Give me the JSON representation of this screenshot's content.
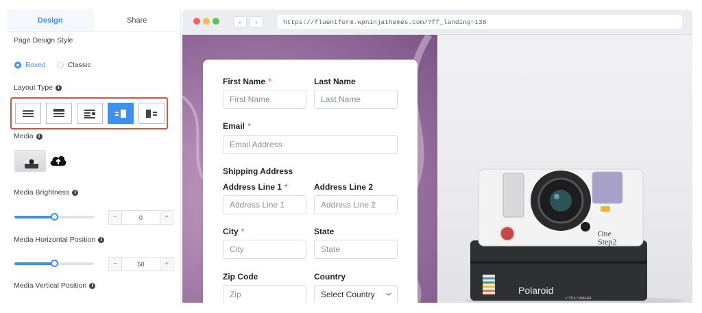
{
  "panel": {
    "tabs": [
      {
        "label": "Design",
        "active": true
      },
      {
        "label": "Share",
        "active": false
      }
    ],
    "page_design_style_label": "Page Design Style",
    "style_options": [
      {
        "label": "Boxed",
        "checked": true
      },
      {
        "label": "Classic",
        "checked": false
      }
    ],
    "layout_type_label": "Layout Type",
    "layout_options_selected_index": 3,
    "media_label": "Media",
    "brightness": {
      "label": "Media Brightness",
      "value": "0",
      "minus": "−",
      "plus": "+"
    },
    "horizontal": {
      "label": "Media Horizontal Position",
      "value": "50",
      "minus": "−",
      "plus": "+"
    },
    "vertical_label": "Media Vertical Position",
    "info_glyph": "i",
    "highlight_color": "#d9533b",
    "accent_color": "#3f8ff2"
  },
  "browser": {
    "url": "https://fluentform.wpninjathemes.com/?ff_landing=138",
    "back_glyph": "‹",
    "forward_glyph": "›",
    "traffic_lights": [
      "#f2655a",
      "#f5bd4f",
      "#57c853"
    ]
  },
  "form": {
    "required_mark": "*",
    "first_name": {
      "label": "First Name",
      "placeholder": "First Name"
    },
    "last_name": {
      "label": "Last Name",
      "placeholder": "Last Name"
    },
    "email": {
      "label": "Email",
      "placeholder": "Email Address"
    },
    "shipping_heading": "Shipping Address",
    "address1": {
      "label": "Address Line 1",
      "placeholder": "Address Line 1"
    },
    "address2": {
      "label": "Address Line 2",
      "placeholder": "Address Line 2"
    },
    "city": {
      "label": "City",
      "placeholder": "City"
    },
    "state": {
      "label": "State",
      "placeholder": "State"
    },
    "zip": {
      "label": "Zip Code",
      "placeholder": "Zip"
    },
    "country": {
      "label": "Country",
      "value": "Select Country"
    }
  },
  "camera": {
    "brand": "Polaroid",
    "model_line1": "One",
    "model_line2": "Step2",
    "sublabel": "i-TYPE CAMERA"
  }
}
